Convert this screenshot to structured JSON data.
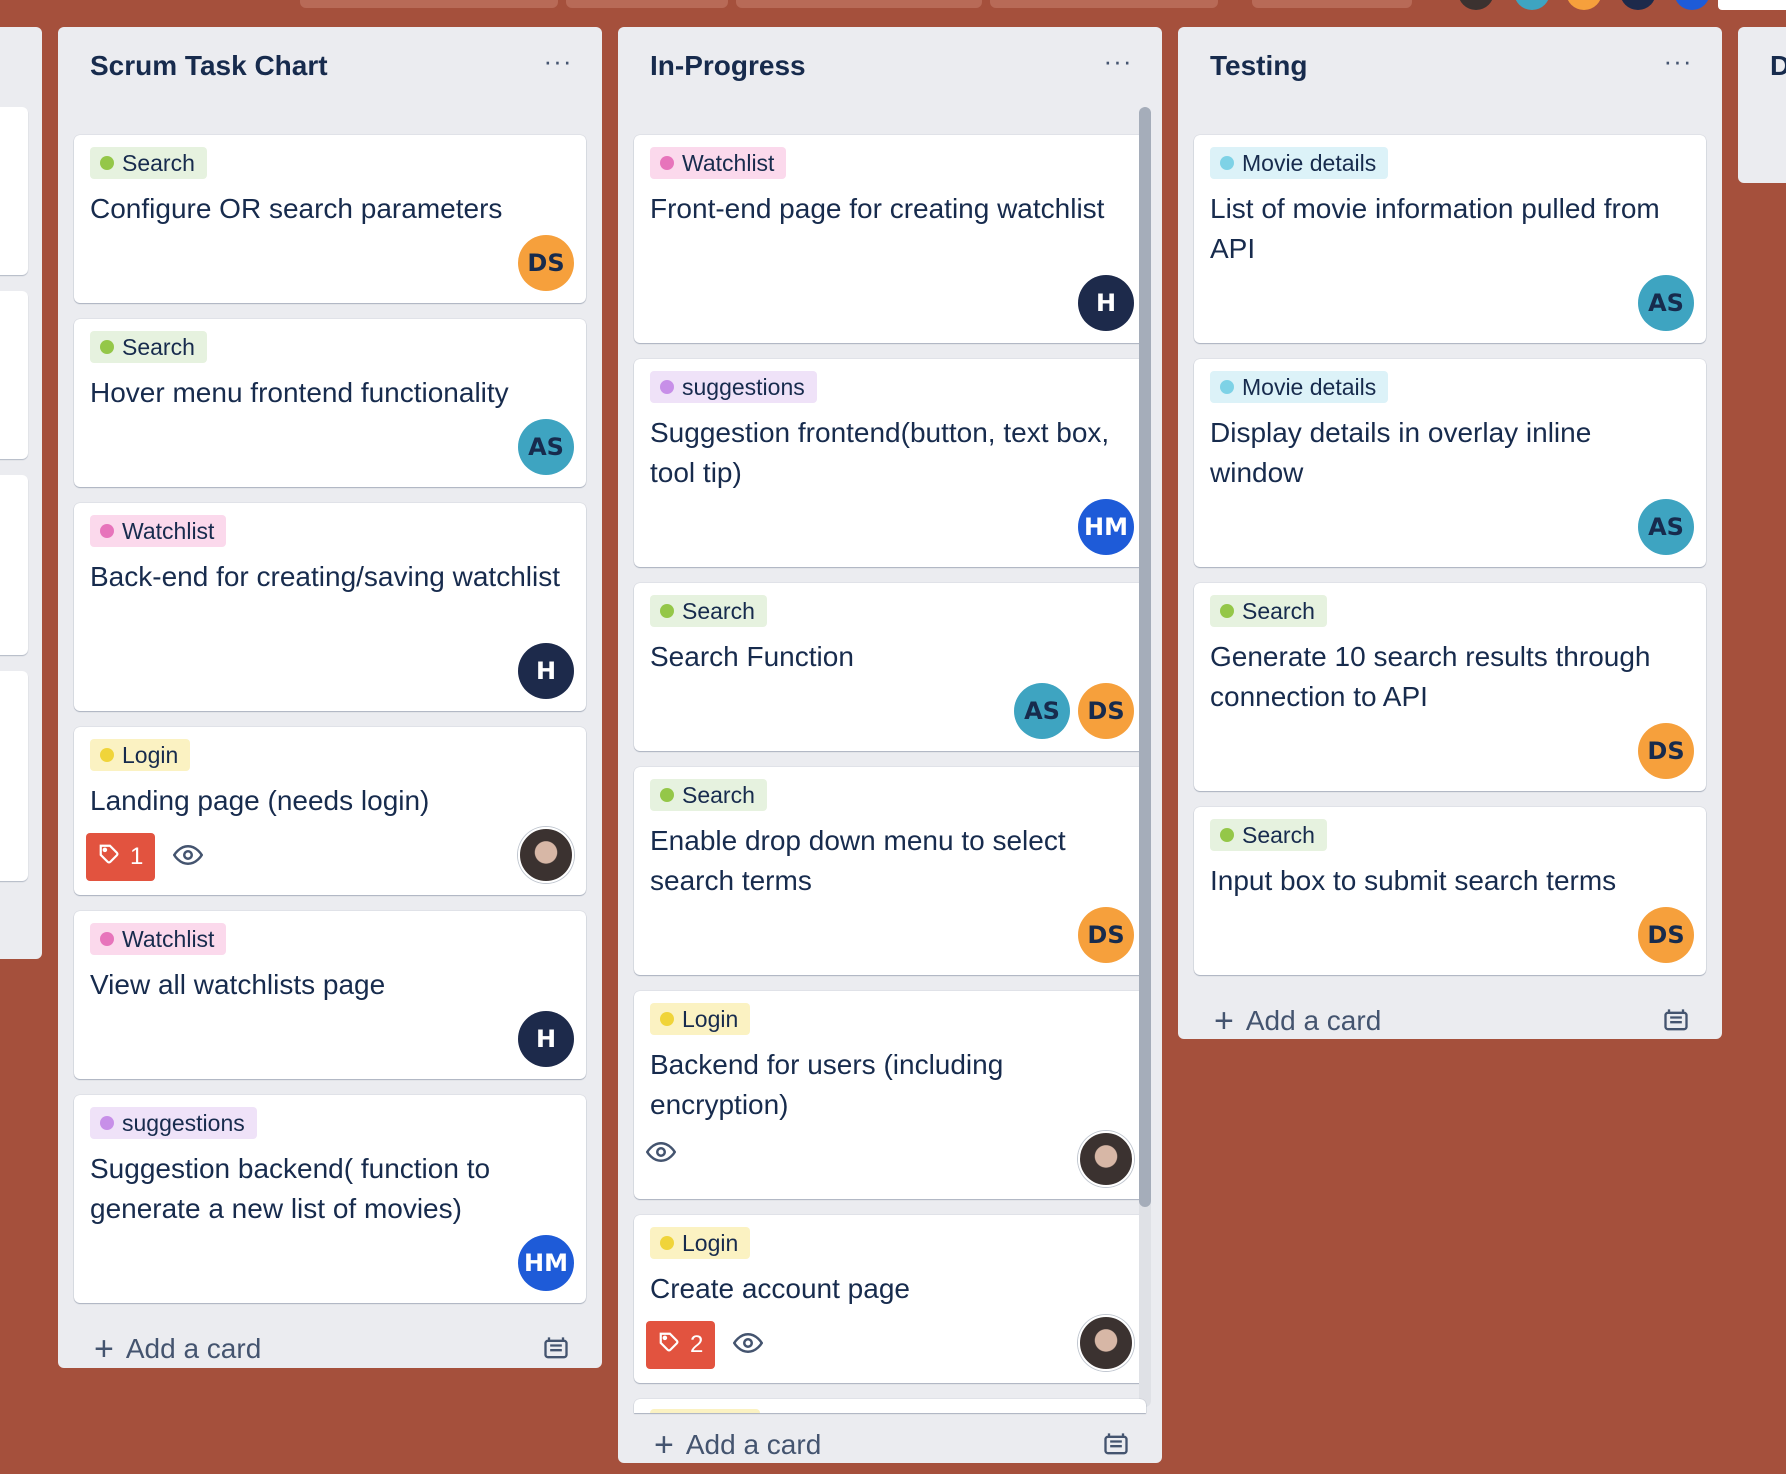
{
  "board": {
    "lists": [
      {
        "title": "Scrum Task Chart",
        "menu": "···",
        "add_label": "Add a card",
        "cards": [
          {
            "label": "Search",
            "title": "Configure OR search parameters",
            "members": [
              "DS"
            ]
          },
          {
            "label": "Search",
            "title": "Hover menu frontend functionality",
            "members": [
              "AS"
            ]
          },
          {
            "label": "Watchlist",
            "title": "Back-end for creating/saving watchlist",
            "members": [
              "H"
            ]
          },
          {
            "label": "Login",
            "title": "Landing page (needs login)",
            "badge_count": "1",
            "members": [
              "photo"
            ]
          },
          {
            "label": "Watchlist",
            "title": "View all watchlists page",
            "members": [
              "H"
            ]
          },
          {
            "label": "suggestions",
            "title": "Suggestion backend( function to generate a new list of movies)",
            "members": [
              "HM"
            ]
          }
        ]
      },
      {
        "title": "In-Progress",
        "menu": "···",
        "add_label": "Add a card",
        "cards": [
          {
            "label": "Watchlist",
            "title": "Front-end page for creating watchlist",
            "members": [
              "H"
            ]
          },
          {
            "label": "suggestions",
            "title": "Suggestion frontend(button, text box, tool tip)",
            "members": [
              "HM"
            ]
          },
          {
            "label": "Search",
            "title": "Search Function",
            "members": [
              "AS",
              "DS"
            ]
          },
          {
            "label": "Search",
            "title": "Enable drop down menu to select search terms",
            "members": [
              "DS"
            ]
          },
          {
            "label": "Login",
            "title": "Backend for users (including encryption)",
            "members": [
              "photo"
            ]
          },
          {
            "label": "Login",
            "title": "Create account page",
            "badge_count": "2",
            "members": [
              "photo"
            ]
          }
        ]
      },
      {
        "title": "Testing",
        "menu": "···",
        "add_label": "Add a card",
        "cards": [
          {
            "label": "Movie details",
            "title": "List of movie information pulled from API",
            "members": [
              "AS"
            ]
          },
          {
            "label": "Movie details",
            "title": "Display details in overlay inline window",
            "members": [
              "AS"
            ]
          },
          {
            "label": "Search",
            "title": "Generate 10 search results through connection to API",
            "members": [
              "DS"
            ]
          },
          {
            "label": "Search",
            "title": "Input box to submit search terms",
            "members": [
              "DS"
            ]
          }
        ]
      }
    ],
    "partial_list_title": "D",
    "label_colors": {
      "Search": {
        "bg": "#e6f2df",
        "dot": "#94c748"
      },
      "Watchlist": {
        "bg": "#fbd9ec",
        "dot": "#e774bb"
      },
      "suggestions": {
        "bg": "#efe2f8",
        "dot": "#c78fe8"
      },
      "Login": {
        "bg": "#fbf2c2",
        "dot": "#f0d43a"
      },
      "Movie details": {
        "bg": "#dcf2f8",
        "dot": "#7ed2e6"
      }
    },
    "avatar_colors": {
      "DS": "#f6a03c",
      "AS": "#3ea4c1",
      "H": "#1d2a4b",
      "HM": "#1e5bd8"
    },
    "background_color": "#a5503c"
  }
}
